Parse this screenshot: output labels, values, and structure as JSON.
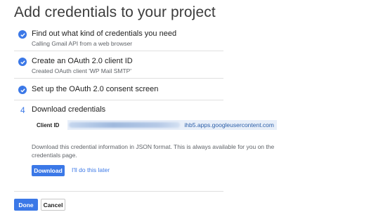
{
  "header": {
    "title": "Add credentials to your project"
  },
  "steps": [
    {
      "status": "done",
      "title": "Find out what kind of credentials you need",
      "subtitle": "Calling Gmail API from a web browser"
    },
    {
      "status": "done",
      "title": "Create an OAuth 2.0 client ID",
      "subtitle": "Created OAuth client 'WP Mail SMTP'"
    },
    {
      "status": "done",
      "title": "Set up the OAuth 2.0 consent screen"
    },
    {
      "status": "active",
      "number": "4",
      "title": "Download credentials"
    }
  ],
  "credentials": {
    "client_id_label": "Client ID",
    "client_id_value": "ihb5.apps.googleusercontent.com",
    "info_text": "Download this credential information in JSON format. This is always available for you on the credentials page.",
    "download_label": "Download",
    "later_label": "I'll do this later"
  },
  "footer": {
    "done_label": "Done",
    "cancel_label": "Cancel"
  },
  "colors": {
    "accent": "#3b78e7",
    "client_id_bg": "#e8eff9",
    "divider": "#e0e0e0"
  },
  "icons": {
    "step_done": "check-circle-icon"
  }
}
